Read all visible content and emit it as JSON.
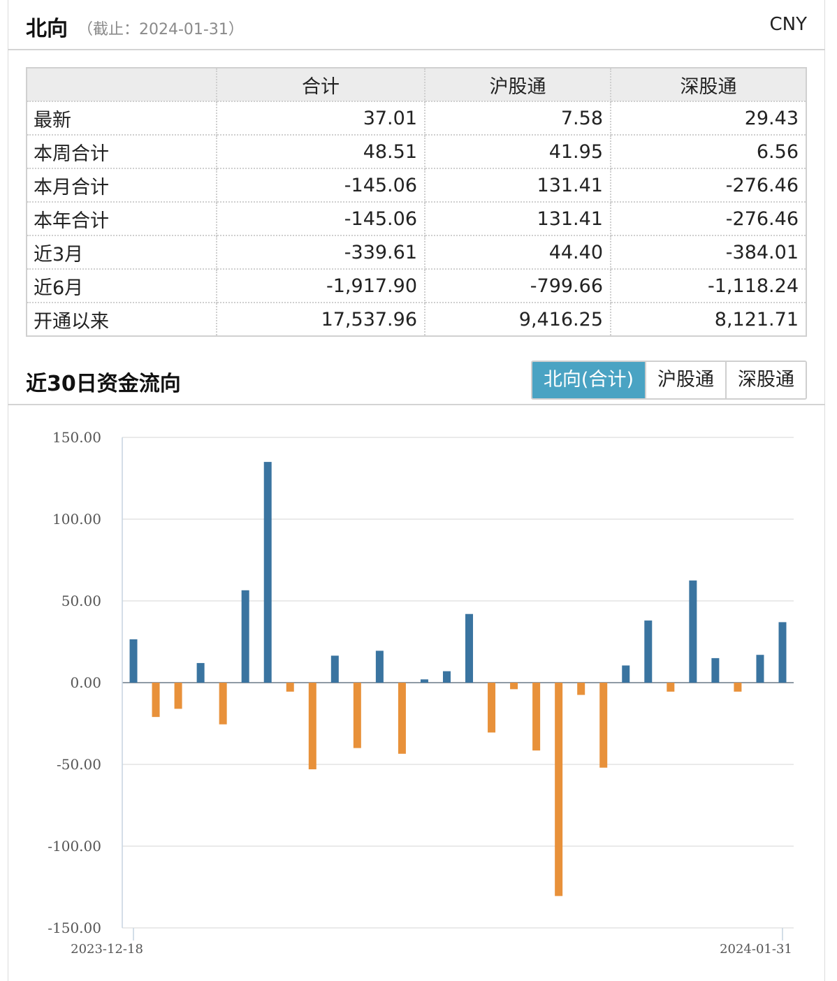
{
  "header": {
    "title": "北向",
    "asof": "（截止：2024-01-31）",
    "currency": "CNY"
  },
  "table": {
    "columns": [
      "",
      "合计",
      "沪股通",
      "深股通"
    ],
    "rows": [
      [
        "最新",
        "37.01",
        "7.58",
        "29.43"
      ],
      [
        "本周合计",
        "48.51",
        "41.95",
        "6.56"
      ],
      [
        "本月合计",
        "-145.06",
        "131.41",
        "-276.46"
      ],
      [
        "本年合计",
        "-145.06",
        "131.41",
        "-276.46"
      ],
      [
        "近3月",
        "-339.61",
        "44.40",
        "-384.01"
      ],
      [
        "近6月",
        "-1,917.90",
        "-799.66",
        "-1,118.24"
      ],
      [
        "开通以来",
        "17,537.96",
        "9,416.25",
        "8,121.71"
      ]
    ]
  },
  "section": {
    "title": "近30日资金流向",
    "tabs": [
      {
        "label": "北向(合计)",
        "active": true
      },
      {
        "label": "沪股通",
        "active": false
      },
      {
        "label": "深股通",
        "active": false
      }
    ]
  },
  "chart_data": {
    "type": "bar",
    "ylim": [
      -150,
      150
    ],
    "yticks": [
      "150.00",
      "100.00",
      "50.00",
      "0.00",
      "-50.00",
      "-100.00",
      "-150.00"
    ],
    "ytick_values": [
      150,
      100,
      50,
      0,
      -50,
      -100,
      -150
    ],
    "x_start_label": "2023-12-18",
    "x_end_label": "2024-01-31",
    "values": [
      26.5,
      -21,
      -16,
      12,
      -25.5,
      56.5,
      135,
      -5.5,
      -53,
      16.5,
      -40,
      19.5,
      -43.5,
      2,
      7,
      42,
      -30.5,
      -4,
      -41.5,
      -130.5,
      -7.5,
      -52,
      10.5,
      38,
      -5.5,
      62.5,
      15,
      -5.5,
      17,
      37
    ],
    "colors": {
      "positive": "#3a74a0",
      "negative": "#e8913a",
      "grid": "#e3e3e3",
      "axis": "#c5d3e0"
    }
  }
}
